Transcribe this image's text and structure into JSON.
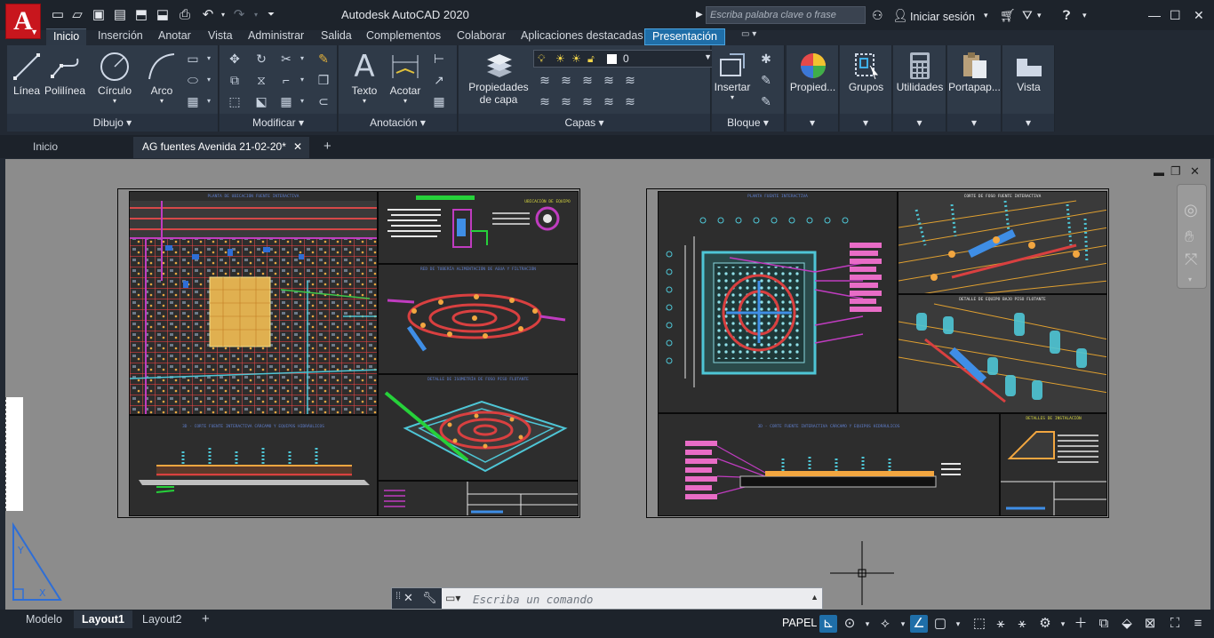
{
  "app": {
    "logo_letter": "A",
    "title": "Autodesk AutoCAD 2020",
    "search_placeholder": "Escriba palabra clave o frase",
    "sign_in": "Iniciar sesión"
  },
  "ribbon_tabs": [
    "Inicio",
    "Inserción",
    "Anotar",
    "Vista",
    "Administrar",
    "Salida",
    "Complementos",
    "Colaborar",
    "Aplicaciones destacadas",
    "Presentación"
  ],
  "ribbon": {
    "draw": {
      "title": "Dibujo",
      "line": "Línea",
      "polyline": "Polilínea",
      "circle": "Círculo",
      "arc": "Arco"
    },
    "modify": {
      "title": "Modificar"
    },
    "annotation": {
      "title": "Anotación",
      "text": "Texto",
      "dimension": "Acotar"
    },
    "layers": {
      "title": "Capas",
      "props_line1": "Propiedades",
      "props_line2": "de capa",
      "current_layer": "0"
    },
    "block": {
      "title": "Bloque",
      "insert": "Insertar"
    },
    "properties": "Propied...",
    "groups": "Grupos",
    "utilities": "Utilidades",
    "clipboard": "Portapap...",
    "view": "Vista"
  },
  "doc_tabs": {
    "home": "Inicio",
    "file": "AG fuentes Avenida 21-02-20*"
  },
  "sheets": {
    "left": {
      "vp1_title": "PLANTA DE UBICACIÓN FUENTE INTERACTIVA",
      "vp3_title": "RED DE TUBERÍA ALIMENTACIÓN DE AGUA Y FILTRACIÓN",
      "vp4_title": "DETALLE DE ISOMETRÍA DE FOSO PISO FLOTANTE",
      "vp5_title": "3D - CORTE FUENTE INTERACTIVA CÁRCAMO Y EQUIPOS HIDRÁULICOS",
      "vp2_title": "UBICACIÓN DE EQUIPO"
    },
    "right": {
      "vp1_title": "PLANTA FUENTE INTERACTIVA",
      "vp2_title": "CORTE DE FOSO FUENTE INTERACTIVA",
      "vp3_title": "DETALLE DE EQUIPO BAJO PISO FLOTANTE",
      "vp4_title": "3D - CORTE FUENTE INTERACTIVA CÁRCAMO Y EQUIPOS HIDRÁULICOS",
      "vp5_title": "DETALLES DE INSTALACIÓN"
    }
  },
  "command": {
    "placeholder": "Escriba un comando"
  },
  "layout_tabs": [
    "Modelo",
    "Layout1",
    "Layout2"
  ],
  "status": {
    "paper": "PAPEL"
  },
  "colors": {
    "accent": "#1f6ea8",
    "ribbon": "#2f3a48",
    "paper": "#8c8c8c",
    "logo": "#c8161d"
  }
}
